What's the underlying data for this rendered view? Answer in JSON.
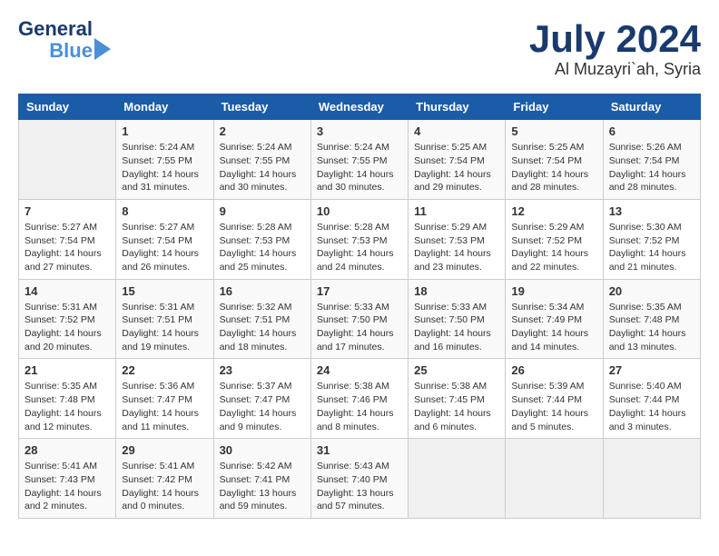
{
  "header": {
    "logo_line1": "General",
    "logo_line2": "Blue",
    "month_year": "July 2024",
    "location": "Al Muzayri`ah, Syria"
  },
  "calendar": {
    "days_of_week": [
      "Sunday",
      "Monday",
      "Tuesday",
      "Wednesday",
      "Thursday",
      "Friday",
      "Saturday"
    ],
    "weeks": [
      [
        {
          "day": "",
          "info": ""
        },
        {
          "day": "1",
          "info": "Sunrise: 5:24 AM\nSunset: 7:55 PM\nDaylight: 14 hours\nand 31 minutes."
        },
        {
          "day": "2",
          "info": "Sunrise: 5:24 AM\nSunset: 7:55 PM\nDaylight: 14 hours\nand 30 minutes."
        },
        {
          "day": "3",
          "info": "Sunrise: 5:24 AM\nSunset: 7:55 PM\nDaylight: 14 hours\nand 30 minutes."
        },
        {
          "day": "4",
          "info": "Sunrise: 5:25 AM\nSunset: 7:54 PM\nDaylight: 14 hours\nand 29 minutes."
        },
        {
          "day": "5",
          "info": "Sunrise: 5:25 AM\nSunset: 7:54 PM\nDaylight: 14 hours\nand 28 minutes."
        },
        {
          "day": "6",
          "info": "Sunrise: 5:26 AM\nSunset: 7:54 PM\nDaylight: 14 hours\nand 28 minutes."
        }
      ],
      [
        {
          "day": "7",
          "info": "Sunrise: 5:27 AM\nSunset: 7:54 PM\nDaylight: 14 hours\nand 27 minutes."
        },
        {
          "day": "8",
          "info": "Sunrise: 5:27 AM\nSunset: 7:54 PM\nDaylight: 14 hours\nand 26 minutes."
        },
        {
          "day": "9",
          "info": "Sunrise: 5:28 AM\nSunset: 7:53 PM\nDaylight: 14 hours\nand 25 minutes."
        },
        {
          "day": "10",
          "info": "Sunrise: 5:28 AM\nSunset: 7:53 PM\nDaylight: 14 hours\nand 24 minutes."
        },
        {
          "day": "11",
          "info": "Sunrise: 5:29 AM\nSunset: 7:53 PM\nDaylight: 14 hours\nand 23 minutes."
        },
        {
          "day": "12",
          "info": "Sunrise: 5:29 AM\nSunset: 7:52 PM\nDaylight: 14 hours\nand 22 minutes."
        },
        {
          "day": "13",
          "info": "Sunrise: 5:30 AM\nSunset: 7:52 PM\nDaylight: 14 hours\nand 21 minutes."
        }
      ],
      [
        {
          "day": "14",
          "info": "Sunrise: 5:31 AM\nSunset: 7:52 PM\nDaylight: 14 hours\nand 20 minutes."
        },
        {
          "day": "15",
          "info": "Sunrise: 5:31 AM\nSunset: 7:51 PM\nDaylight: 14 hours\nand 19 minutes."
        },
        {
          "day": "16",
          "info": "Sunrise: 5:32 AM\nSunset: 7:51 PM\nDaylight: 14 hours\nand 18 minutes."
        },
        {
          "day": "17",
          "info": "Sunrise: 5:33 AM\nSunset: 7:50 PM\nDaylight: 14 hours\nand 17 minutes."
        },
        {
          "day": "18",
          "info": "Sunrise: 5:33 AM\nSunset: 7:50 PM\nDaylight: 14 hours\nand 16 minutes."
        },
        {
          "day": "19",
          "info": "Sunrise: 5:34 AM\nSunset: 7:49 PM\nDaylight: 14 hours\nand 14 minutes."
        },
        {
          "day": "20",
          "info": "Sunrise: 5:35 AM\nSunset: 7:48 PM\nDaylight: 14 hours\nand 13 minutes."
        }
      ],
      [
        {
          "day": "21",
          "info": "Sunrise: 5:35 AM\nSunset: 7:48 PM\nDaylight: 14 hours\nand 12 minutes."
        },
        {
          "day": "22",
          "info": "Sunrise: 5:36 AM\nSunset: 7:47 PM\nDaylight: 14 hours\nand 11 minutes."
        },
        {
          "day": "23",
          "info": "Sunrise: 5:37 AM\nSunset: 7:47 PM\nDaylight: 14 hours\nand 9 minutes."
        },
        {
          "day": "24",
          "info": "Sunrise: 5:38 AM\nSunset: 7:46 PM\nDaylight: 14 hours\nand 8 minutes."
        },
        {
          "day": "25",
          "info": "Sunrise: 5:38 AM\nSunset: 7:45 PM\nDaylight: 14 hours\nand 6 minutes."
        },
        {
          "day": "26",
          "info": "Sunrise: 5:39 AM\nSunset: 7:44 PM\nDaylight: 14 hours\nand 5 minutes."
        },
        {
          "day": "27",
          "info": "Sunrise: 5:40 AM\nSunset: 7:44 PM\nDaylight: 14 hours\nand 3 minutes."
        }
      ],
      [
        {
          "day": "28",
          "info": "Sunrise: 5:41 AM\nSunset: 7:43 PM\nDaylight: 14 hours\nand 2 minutes."
        },
        {
          "day": "29",
          "info": "Sunrise: 5:41 AM\nSunset: 7:42 PM\nDaylight: 14 hours\nand 0 minutes."
        },
        {
          "day": "30",
          "info": "Sunrise: 5:42 AM\nSunset: 7:41 PM\nDaylight: 13 hours\nand 59 minutes."
        },
        {
          "day": "31",
          "info": "Sunrise: 5:43 AM\nSunset: 7:40 PM\nDaylight: 13 hours\nand 57 minutes."
        },
        {
          "day": "",
          "info": ""
        },
        {
          "day": "",
          "info": ""
        },
        {
          "day": "",
          "info": ""
        }
      ]
    ]
  }
}
